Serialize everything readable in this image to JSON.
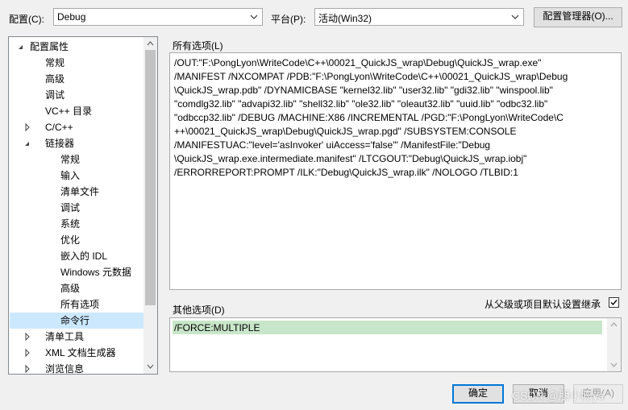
{
  "toolbar": {
    "config_label": "配置(C):",
    "config_value": "Debug",
    "platform_label": "平台(P):",
    "platform_value": "活动(Win32)",
    "config_manager_button": "配置管理器(O)..."
  },
  "tree": {
    "items": [
      {
        "label": "配置属性",
        "expander": "expanded"
      },
      {
        "label": "常规",
        "expander": "none"
      },
      {
        "label": "高级",
        "expander": "none"
      },
      {
        "label": "调试",
        "expander": "none"
      },
      {
        "label": "VC++ 目录",
        "expander": "none"
      },
      {
        "label": "C/C++",
        "expander": "collapsed"
      },
      {
        "label": "链接器",
        "expander": "expanded"
      },
      {
        "label": "常规",
        "expander": "none"
      },
      {
        "label": "输入",
        "expander": "none"
      },
      {
        "label": "清单文件",
        "expander": "none"
      },
      {
        "label": "调试",
        "expander": "none"
      },
      {
        "label": "系统",
        "expander": "none"
      },
      {
        "label": "优化",
        "expander": "none"
      },
      {
        "label": "嵌入的 IDL",
        "expander": "none"
      },
      {
        "label": "Windows 元数据",
        "expander": "none"
      },
      {
        "label": "高级",
        "expander": "none"
      },
      {
        "label": "所有选项",
        "expander": "none"
      },
      {
        "label": "命令行",
        "expander": "none",
        "selected": true
      },
      {
        "label": "清单工具",
        "expander": "collapsed"
      },
      {
        "label": "XML 文档生成器",
        "expander": "collapsed"
      },
      {
        "label": "浏览信息",
        "expander": "collapsed"
      }
    ]
  },
  "all_options": {
    "label": "所有选项(L)",
    "lines": [
      "/OUT:\"F:\\PongLyon\\WriteCode\\C++\\00021_QuickJS_wrap\\Debug\\QuickJS_wrap.exe\"",
      "/MANIFEST /NXCOMPAT /PDB:\"F:\\PongLyon\\WriteCode\\C++\\00021_QuickJS_wrap\\Debug",
      "\\QuickJS_wrap.pdb\" /DYNAMICBASE \"kernel32.lib\" \"user32.lib\" \"gdi32.lib\" \"winspool.lib\"",
      "\"comdlg32.lib\" \"advapi32.lib\" \"shell32.lib\" \"ole32.lib\" \"oleaut32.lib\" \"uuid.lib\" \"odbc32.lib\"",
      "\"odbccp32.lib\" /DEBUG /MACHINE:X86 /INCREMENTAL /PGD:\"F:\\PongLyon\\WriteCode\\C",
      "++\\00021_QuickJS_wrap\\Debug\\QuickJS_wrap.pgd\" /SUBSYSTEM:CONSOLE",
      "/MANIFESTUAC:\"level='asInvoker' uiAccess='false'\" /ManifestFile:\"Debug",
      "\\QuickJS_wrap.exe.intermediate.manifest\" /LTCGOUT:\"Debug\\QuickJS_wrap.iobj\"",
      "/ERRORREPORT:PROMPT /ILK:\"Debug\\QuickJS_wrap.ilk\" /NOLOGO /TLBID:1"
    ]
  },
  "other_options": {
    "label": "其他选项(D)",
    "value": "/FORCE:MULTIPLE",
    "inherit_label": "从父级或项目默认设置继承",
    "inherit_checked": true
  },
  "footer": {
    "ok": "确定",
    "cancel": "取消",
    "apply": "应用(A)",
    "watermark": "CSDN @朋小陈ya"
  },
  "colors": {
    "selection": "#cce8ff",
    "input_highlight": "#c8e6c9",
    "accent_border": "#0078d7"
  }
}
